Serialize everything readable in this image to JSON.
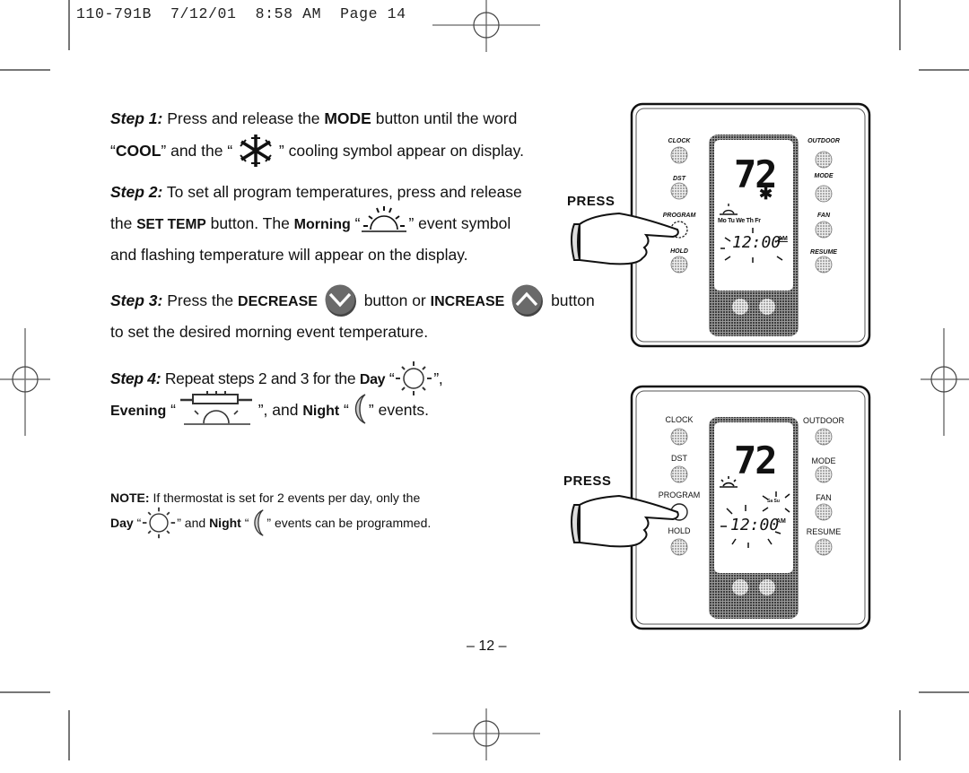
{
  "slug": {
    "doc_id": "110-791B",
    "date": "7/12/01",
    "time": "8:58 AM",
    "page": "Page 14"
  },
  "steps": [
    {
      "label": "Step 1:",
      "line1": [
        "Press and release the ",
        "MODE",
        " button until the word"
      ],
      "line2": [
        "“",
        "COOL",
        "” and the “",
        "” cooling symbol appear on display."
      ],
      "icon": "snowflake-icon"
    },
    {
      "label": "Step 2:",
      "line1": "To set all program temperatures, press and release",
      "line2": [
        "the ",
        "SET TEMP",
        " button. The ",
        "Morning",
        " “",
        "” event symbol"
      ],
      "line3": "and flashing temperature will appear on the display.",
      "icon": "morning-sun-icon"
    },
    {
      "label": "Step 3:",
      "line1": [
        "Press the ",
        "DECREASE",
        " button or ",
        "INCREASE",
        " button"
      ],
      "line2": "to set the desired morning event temperature.",
      "icons": [
        "decrease-button-icon",
        "increase-button-icon"
      ]
    },
    {
      "label": "Step 4:",
      "line1": [
        "Repeat steps 2 and 3 for the ",
        "Day",
        " “",
        "”,"
      ],
      "line2": [
        "Evening",
        " “",
        "”, and ",
        "Night",
        " “",
        "” events."
      ],
      "icons": [
        "day-sun-icon",
        "evening-icon",
        "night-moon-icon"
      ]
    }
  ],
  "note": {
    "label": "NOTE:",
    "line1": "If thermostat is set for 2 events per day, only the",
    "line2": [
      "Day",
      " “",
      "” and ",
      "Night",
      " “",
      "” events can be programmed."
    ]
  },
  "illustrations": [
    {
      "press_label": "PRESS",
      "left_buttons": [
        "CLOCK",
        "DST",
        "PROGRAM",
        "HOLD"
      ],
      "right_buttons": [
        "OUTDOOR",
        "MODE",
        "FAN",
        "RESUME"
      ],
      "display": {
        "temperature": "72",
        "days": "Mo Tu We Th Fr",
        "time": "12:00",
        "ampm": "AM",
        "mode_symbol": "snowflake"
      }
    },
    {
      "press_label": "PRESS",
      "left_buttons": [
        "CLOCK",
        "DST",
        "PROGRAM",
        "HOLD"
      ],
      "right_buttons": [
        "OUTDOOR",
        "MODE",
        "FAN",
        "RESUME"
      ],
      "display": {
        "temperature": "72",
        "days": "Sa Su",
        "time": "12:00",
        "ampm": "AM"
      }
    }
  ],
  "page_number": "– 12 –"
}
